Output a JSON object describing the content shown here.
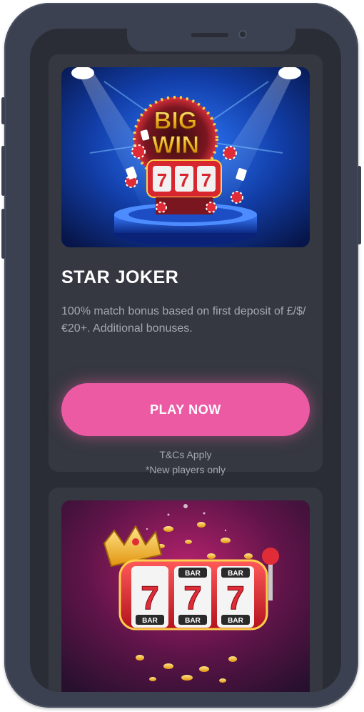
{
  "offer": {
    "title": "STAR JOKER",
    "description": "100% match bonus based on first deposit of £/$/€20+. Additional bonuses.",
    "cta_label": "PLAY NOW",
    "terms_line1": "T&Cs Apply",
    "terms_line2": "*New players only"
  },
  "banner_1": {
    "sign_line1": "BIG",
    "sign_line2": "WIN",
    "reel_symbols": [
      "7",
      "7",
      "7"
    ]
  },
  "banner_2": {
    "reel_top_labels": [
      "BAR",
      "BAR"
    ],
    "reel_symbols": [
      "7",
      "7",
      "7"
    ],
    "reel_bottom_labels": [
      "BAR",
      "BAR",
      "BAR"
    ]
  },
  "colors": {
    "cta": "#ec5aa3",
    "card": "#353840",
    "screen": "#2a2d35",
    "frame": "#3b4150"
  }
}
